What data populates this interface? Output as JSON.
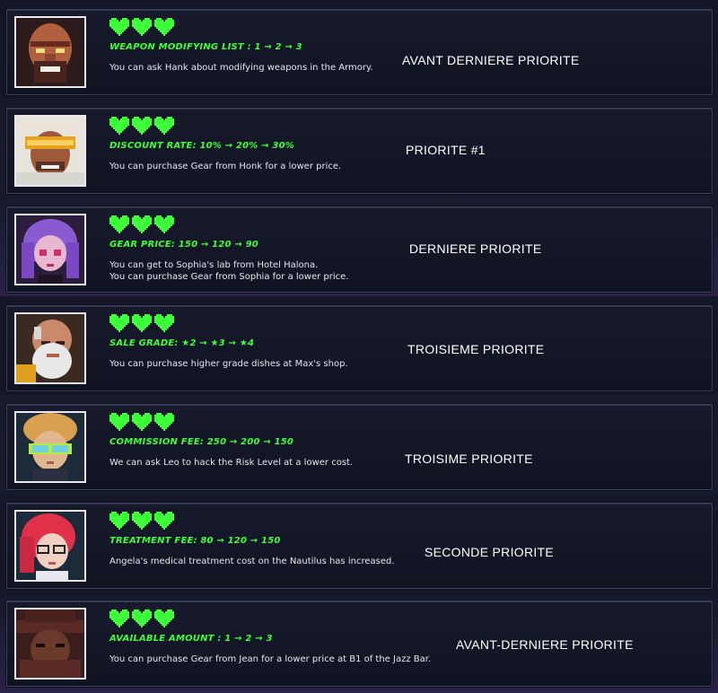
{
  "colors": {
    "heart": "#3dff3a",
    "stat_text": "#3dff3a",
    "card_border": "#3d4160",
    "background": "#141624"
  },
  "cards": [
    {
      "character_icon": "bald-bearded-man-portrait-icon",
      "stat": "WEAPON MODIFYING LIST : 1 → 2 → 3",
      "description": [
        "You can ask Hank about modifying weapons in the Armory."
      ],
      "note": "AVANT DERNIERE PRIORITE",
      "hearts": 3
    },
    {
      "character_icon": "visor-man-portrait-icon",
      "stat": "DISCOUNT RATE: 10% → 20% → 30%",
      "description": [
        "You can purchase Gear from Honk for a lower price."
      ],
      "note": "PRIORITE #1",
      "hearts": 3
    },
    {
      "character_icon": "purple-haired-girl-portrait-icon",
      "stat": "GEAR PRICE: 150 → 120 → 90",
      "description": [
        "You can get to Sophia's lab from Hotel Halona.",
        "You can purchase Gear from Sophia for a lower price."
      ],
      "note": "DERNIERE PRIORITE",
      "hearts": 3
    },
    {
      "character_icon": "old-bearded-man-portrait-icon",
      "stat": "SALE GRADE: ★2 → ★3 → ★4",
      "description": [
        "You can purchase higher grade dishes at Max's shop."
      ],
      "note": "TROISIEME PRIORITE",
      "hearts": 3
    },
    {
      "character_icon": "goggles-hacker-portrait-icon",
      "stat": "COMMISSION FEE: 250 → 200 → 150",
      "description": [
        "We can ask Leo to hack the Risk Level at a lower cost."
      ],
      "note": "TROISIME PRIORITE",
      "hearts": 3
    },
    {
      "character_icon": "red-haired-doctor-portrait-icon",
      "stat": "TREATMENT FEE: 80 → 120 → 150",
      "description": [
        "Angela's medical treatment cost on the Nautilus has increased."
      ],
      "note": "SECONDE PRIORITE",
      "hearts": 3
    },
    {
      "character_icon": "hooded-man-portrait-icon",
      "stat": "AVAILABLE AMOUNT : 1 → 2 → 3",
      "description": [
        "You can purchase Gear from Jean for a lower price at B1 of the Jazz Bar."
      ],
      "note": "AVANT-DERNIERE PRIORITE",
      "hearts": 3
    }
  ]
}
